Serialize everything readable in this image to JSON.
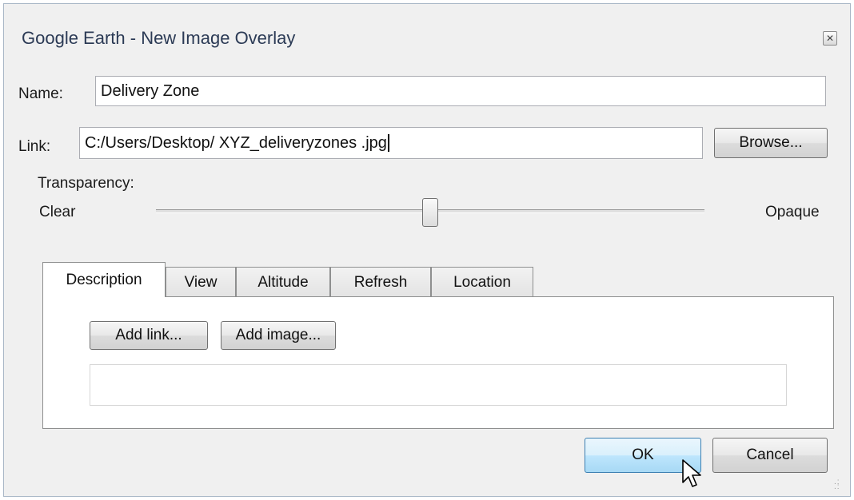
{
  "window": {
    "title": "Google Earth - New Image Overlay",
    "close_icon": "close-icon"
  },
  "name_field": {
    "label": "Name:",
    "value": "Delivery Zone"
  },
  "link_field": {
    "label": "Link:",
    "value": "C:/Users/Desktop/ XYZ_deliveryzones .jpg",
    "browse_label": "Browse..."
  },
  "transparency": {
    "label": "Transparency:",
    "min_label": "Clear",
    "max_label": "Opaque",
    "level": 0.5
  },
  "tabs": [
    {
      "label": "Description",
      "active": true
    },
    {
      "label": "View",
      "active": false
    },
    {
      "label": "Altitude",
      "active": false
    },
    {
      "label": "Refresh",
      "active": false
    },
    {
      "label": "Location",
      "active": false
    }
  ],
  "description_tab": {
    "add_link_label": "Add link...",
    "add_image_label": "Add image...",
    "description_value": ""
  },
  "footer": {
    "ok_label": "OK",
    "cancel_label": "Cancel"
  },
  "colors": {
    "dialog_bg": "#f0f0f0",
    "title_text": "#2b3a55",
    "ok_accent": "#a7d9f5"
  }
}
